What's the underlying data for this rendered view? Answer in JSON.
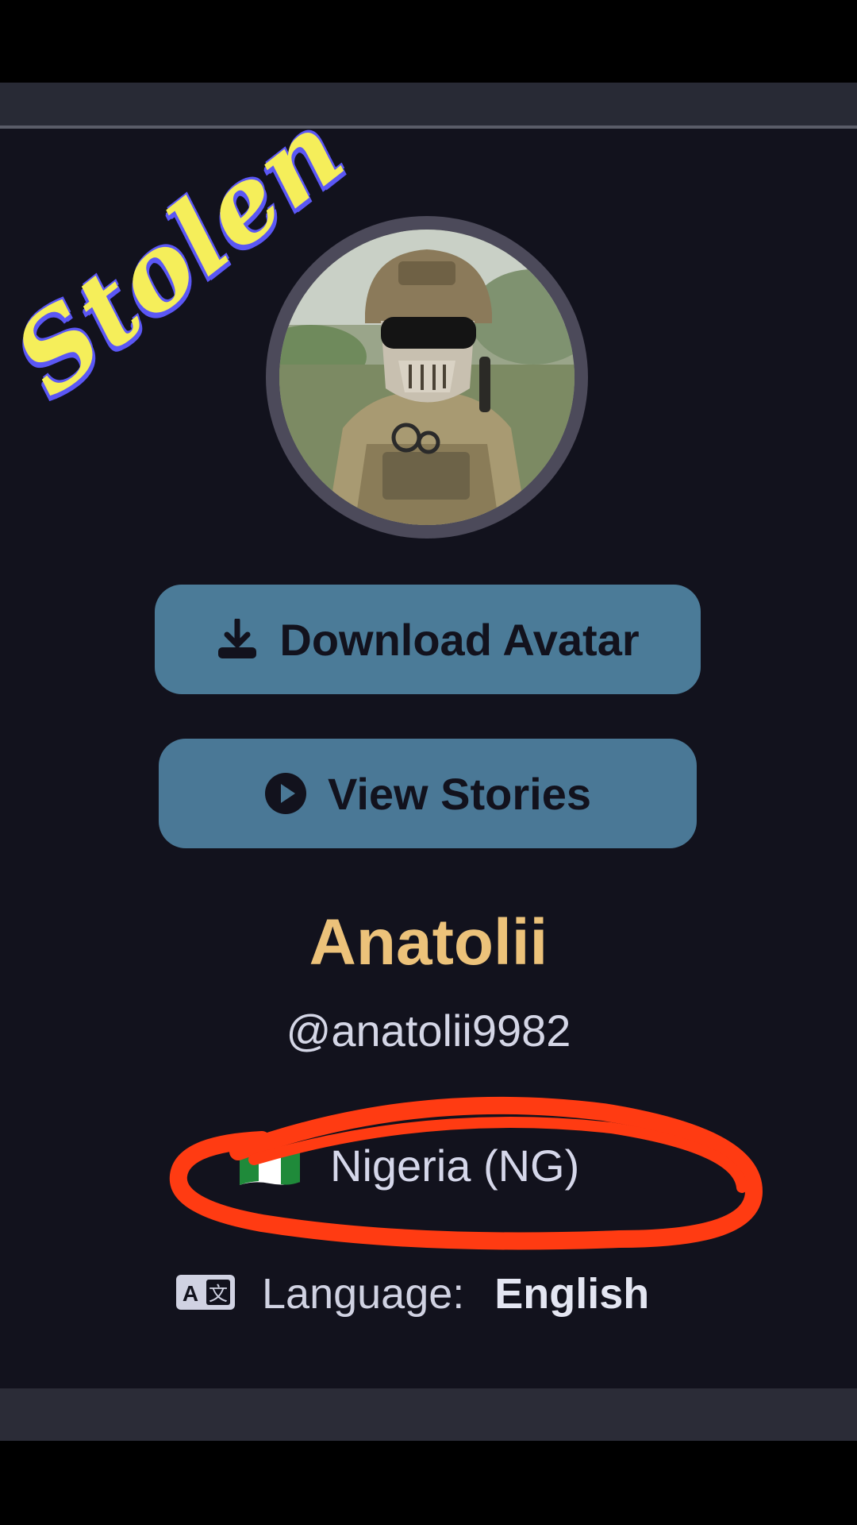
{
  "overlay": {
    "watermark_text": "Stolen"
  },
  "profile": {
    "download_button_label": "Download Avatar",
    "download_icon": "download-icon",
    "stories_button_label": "View Stories",
    "stories_icon": "play-circle-icon",
    "display_name": "Anatolii",
    "username": "@anatolii9982",
    "country": {
      "flag_icon": "nigeria-flag-icon",
      "label": "Nigeria (NG)"
    },
    "language": {
      "icon": "translate-icon",
      "label": "Language:",
      "value": "English"
    }
  },
  "colors": {
    "background": "#12121d",
    "button": "#4b7b98",
    "name": "#ecc27a",
    "annotation_circle": "#ff3b12",
    "watermark_fill": "#f5ee5a",
    "watermark_outline": "#5b57f5"
  }
}
